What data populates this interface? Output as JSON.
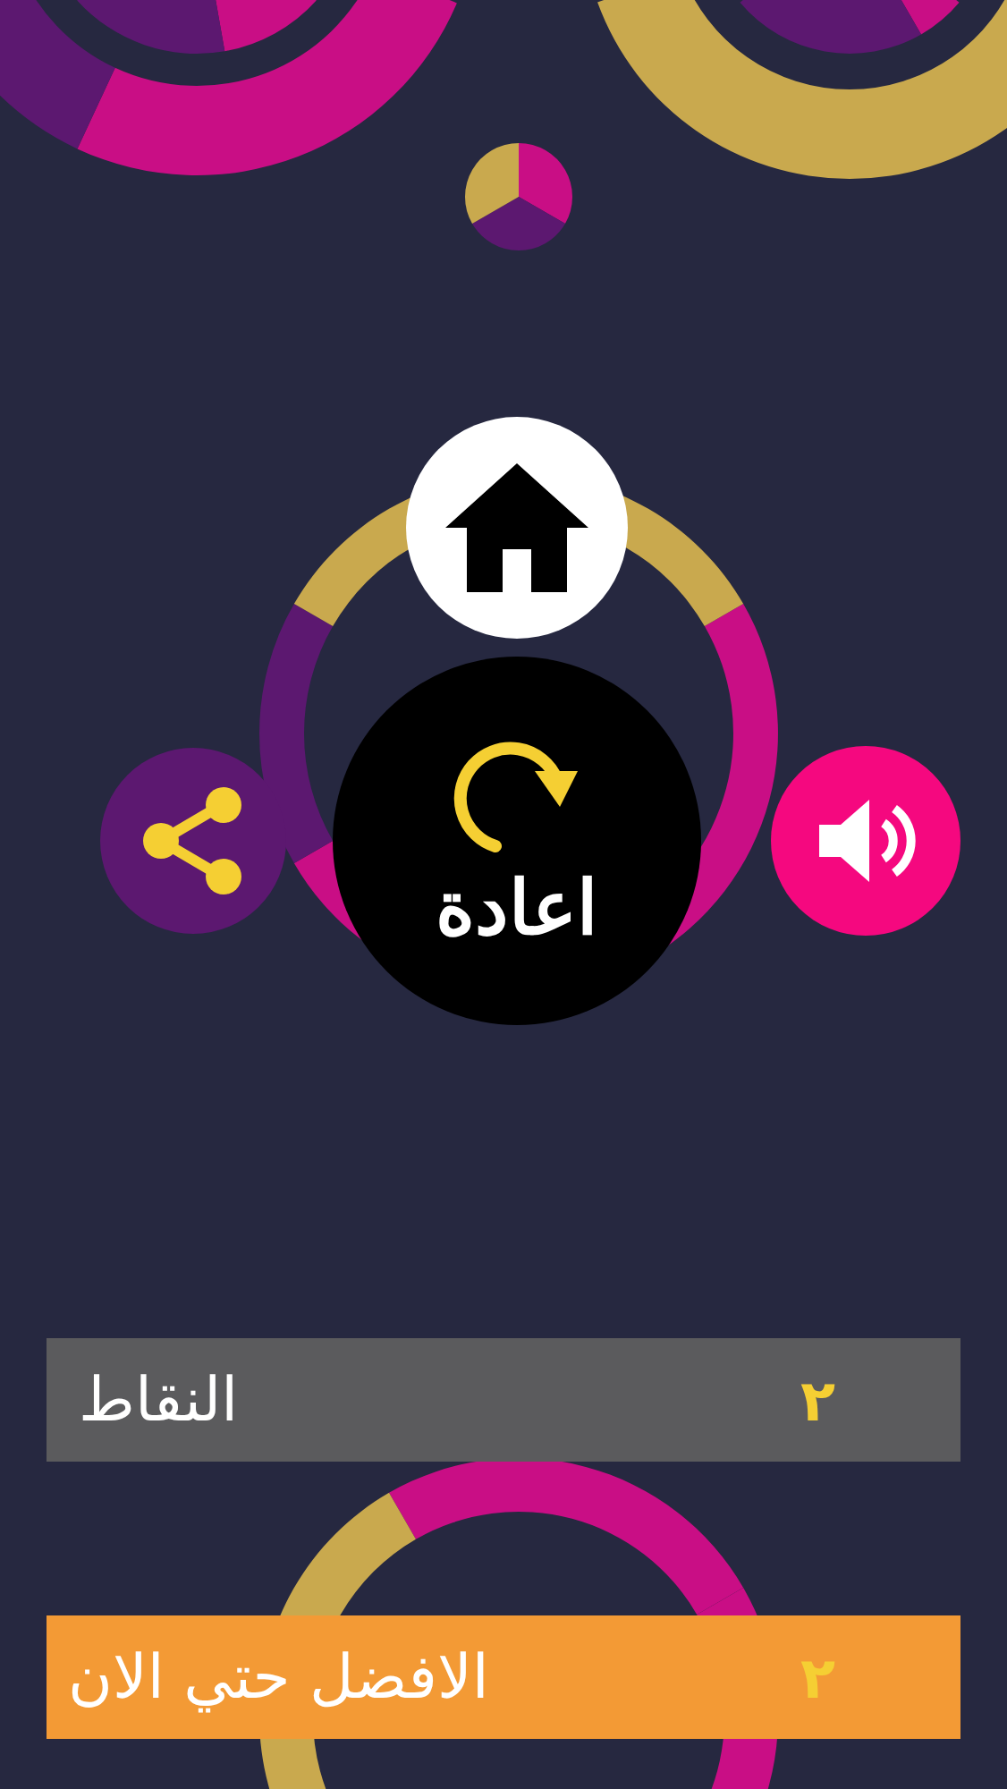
{
  "replay_button": {
    "label": "اعادة"
  },
  "score": {
    "label": "النقاط",
    "value": "٢"
  },
  "best": {
    "label": "الافضل حتي الان",
    "value": "٢"
  }
}
